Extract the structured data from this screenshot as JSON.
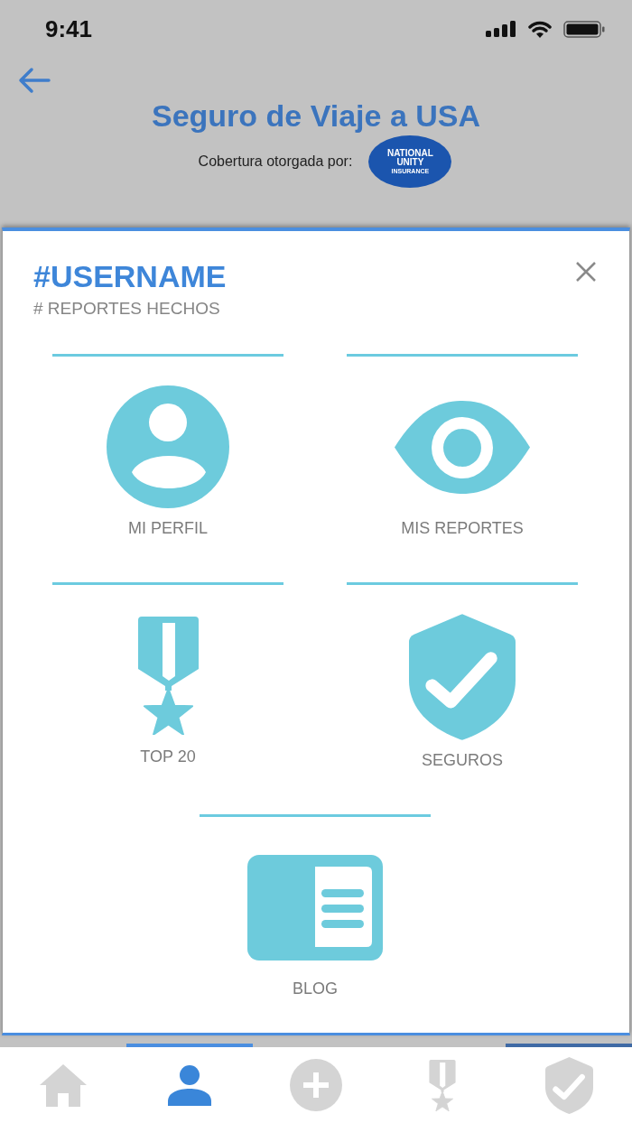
{
  "status_bar": {
    "time": "9:41"
  },
  "header": {
    "title": "Seguro de Viaje a USA",
    "coverage_label": "Cobertura otorgada por:",
    "logo": {
      "lines": [
        "NATIONAL",
        "UNITY",
        "INSURANCE"
      ]
    }
  },
  "modal": {
    "username": "#USERNAME",
    "subtitle": "# REPORTES HECHOS",
    "items": [
      {
        "kind": "profile",
        "label": "MI PERFIL"
      },
      {
        "kind": "reports",
        "label": "MIS REPORTES"
      },
      {
        "kind": "ranking",
        "label": "TOP 20"
      },
      {
        "kind": "insurance",
        "label": "SEGUROS"
      },
      {
        "kind": "blog",
        "label": "BLOG"
      }
    ]
  },
  "tab_bar": {
    "tabs": [
      {
        "kind": "home",
        "selected": false,
        "indicator": false
      },
      {
        "kind": "profile",
        "selected": true,
        "indicator": true
      },
      {
        "kind": "add",
        "selected": false,
        "indicator": false
      },
      {
        "kind": "ranking",
        "selected": false,
        "indicator": false
      },
      {
        "kind": "insurance",
        "selected": false,
        "indicator": true
      }
    ]
  }
}
